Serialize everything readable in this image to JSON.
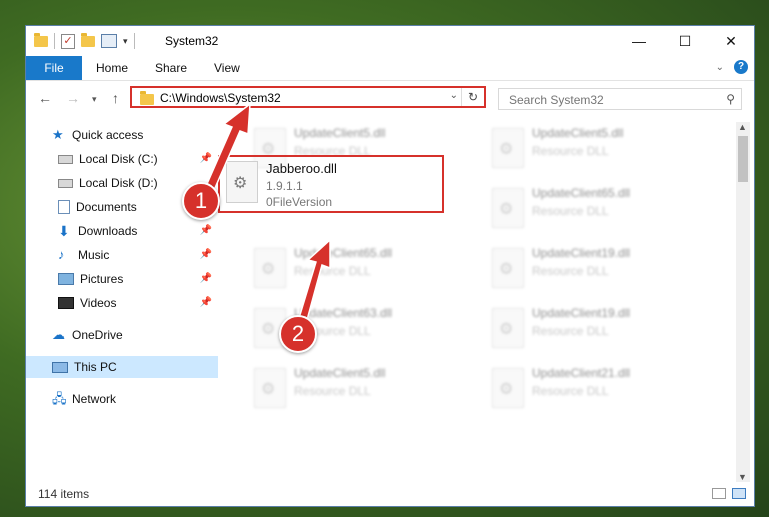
{
  "window": {
    "title": "System32"
  },
  "titlebar_controls": {
    "minimize": "—",
    "maximize": "☐",
    "close": "✕"
  },
  "ribbon": {
    "tabs": [
      "File",
      "Home",
      "Share",
      "View"
    ]
  },
  "address": {
    "path": "C:\\Windows\\System32"
  },
  "search": {
    "placeholder": "Search System32"
  },
  "sidebar": {
    "items": [
      {
        "label": "Quick access",
        "icon": "star-icon"
      },
      {
        "label": "Local Disk (C:)",
        "icon": "drive-icon",
        "pinned": true
      },
      {
        "label": "Local Disk (D:)",
        "icon": "drive-icon"
      },
      {
        "label": "Documents",
        "icon": "documents-icon",
        "pinned": true
      },
      {
        "label": "Downloads",
        "icon": "download-icon",
        "pinned": true
      },
      {
        "label": "Music",
        "icon": "music-icon",
        "pinned": true
      },
      {
        "label": "Pictures",
        "icon": "pictures-icon",
        "pinned": true
      },
      {
        "label": "Videos",
        "icon": "videos-icon",
        "pinned": true
      },
      {
        "label": "OneDrive",
        "icon": "cloud-icon"
      },
      {
        "label": "This PC",
        "icon": "computer-icon",
        "selected": true
      },
      {
        "label": "Network",
        "icon": "network-icon"
      }
    ]
  },
  "files": {
    "left": [
      {
        "name": "UpdateClient5.dll",
        "desc": "Resource DLL"
      },
      {
        "name": "UpdateClient65.dll",
        "desc": "Resource DLL"
      },
      {
        "name": "UpdateClient63.dll",
        "desc": "Resource DLL"
      },
      {
        "name": "UpdateClient5.dll",
        "desc": "Resource DLL"
      }
    ],
    "right": [
      {
        "name": "UpdateClient5.dll",
        "desc": "Resource DLL"
      },
      {
        "name": "UpdateClient65.dll",
        "desc": "Resource DLL"
      },
      {
        "name": "UpdateClient19.dll",
        "desc": "Resource DLL"
      },
      {
        "name": "UpdateClient19.dll",
        "desc": "Resource DLL"
      },
      {
        "name": "UpdateClient21.dll",
        "desc": "Resource DLL"
      }
    ],
    "highlighted": {
      "name": "Jabberoo.dll",
      "version": "1.9.1.1",
      "desc": "0FileVersion"
    }
  },
  "status": {
    "items_count": "114 items"
  },
  "annotations": {
    "step1": "1",
    "step2": "2",
    "color": "#d6312b"
  }
}
